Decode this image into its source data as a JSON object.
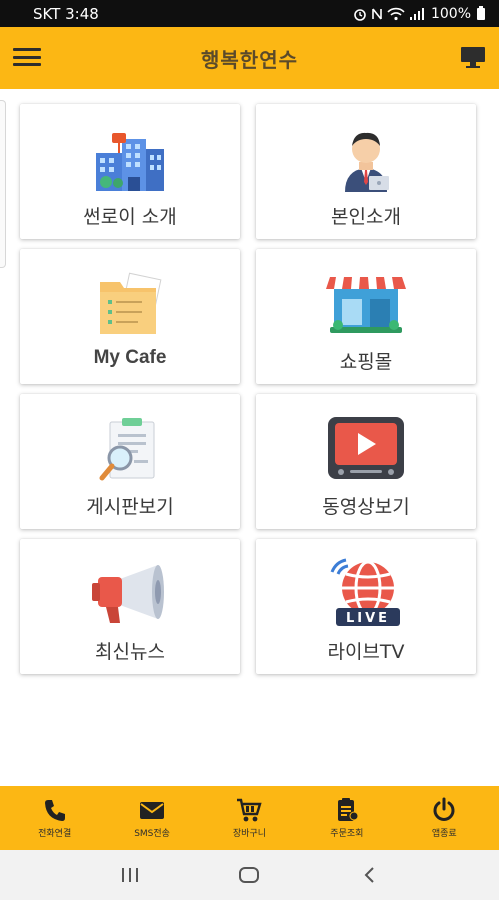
{
  "status_bar": {
    "carrier_time": "SKT 3:48",
    "battery": "100%"
  },
  "header": {
    "title": "행복한연수",
    "menu_icon": "hamburger-menu-icon",
    "monitor_icon": "monitor-icon"
  },
  "tiles": [
    {
      "label": "썬로이 소개",
      "icon": "building-icon"
    },
    {
      "label": "본인소개",
      "icon": "businessman-icon"
    },
    {
      "label": "My Cafe",
      "icon": "folder-documents-icon"
    },
    {
      "label": "쇼핑몰",
      "icon": "storefront-icon"
    },
    {
      "label": "게시판보기",
      "icon": "document-search-icon"
    },
    {
      "label": "동영상보기",
      "icon": "video-play-icon"
    },
    {
      "label": "최신뉴스",
      "icon": "megaphone-icon"
    },
    {
      "label": "라이브TV",
      "icon": "live-globe-icon"
    }
  ],
  "bottom_bar": [
    {
      "label": "전화연결",
      "icon": "phone-icon"
    },
    {
      "label": "SMS전송",
      "icon": "envelope-icon"
    },
    {
      "label": "장바구니",
      "icon": "cart-icon"
    },
    {
      "label": "주문조회",
      "icon": "order-lookup-icon"
    },
    {
      "label": "앱종료",
      "icon": "power-icon"
    }
  ],
  "colors": {
    "accent": "#fcb714",
    "tile_text": "#3a3a3a",
    "status_bar": "#0f0f0f"
  }
}
